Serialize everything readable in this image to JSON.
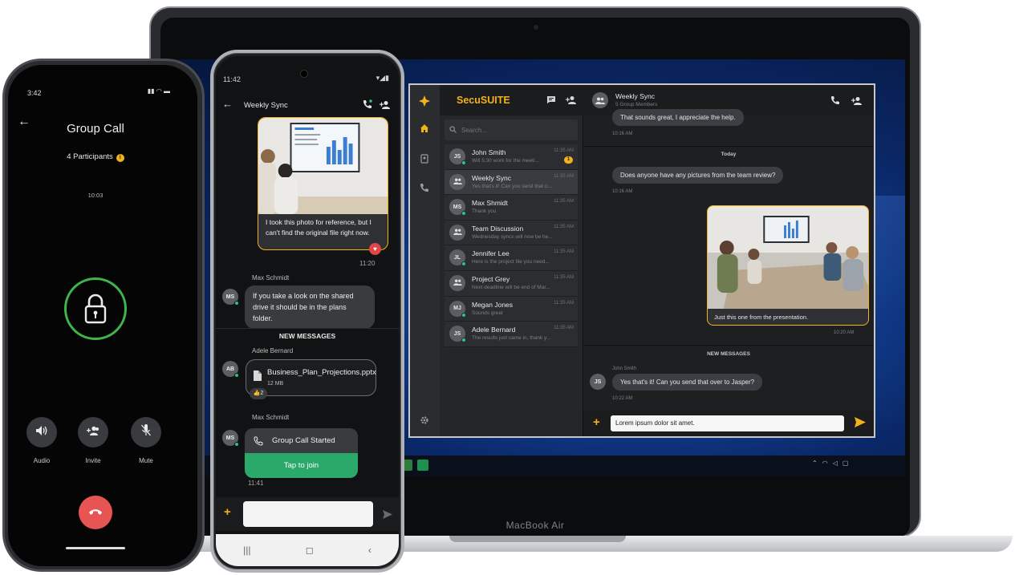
{
  "laptop": {
    "brand_label": "MacBook Air",
    "app": {
      "title": "SecuSUITE",
      "search_placeholder": "Search...",
      "conversations": [
        {
          "initials": "JS",
          "name": "John Smith",
          "preview": "Will 5:30 work for the meeti...",
          "time": "11:35 AM",
          "badge": "1",
          "type": "person"
        },
        {
          "initials": "",
          "name": "Weekly Sync",
          "preview": "Yes that's it! Can you send that o...",
          "time": "11:35 AM",
          "badge": "",
          "type": "group",
          "active": true
        },
        {
          "initials": "MS",
          "name": "Max Shmidt",
          "preview": "Thank you",
          "time": "11:35 AM",
          "badge": "",
          "type": "person"
        },
        {
          "initials": "",
          "name": "Team Discussion",
          "preview": "Wednesday syncs will now be he...",
          "time": "11:35 AM",
          "badge": "",
          "type": "group"
        },
        {
          "initials": "JL",
          "name": "Jennifer Lee",
          "preview": "Here is the project file you need...",
          "time": "11:35 AM",
          "badge": "",
          "type": "person"
        },
        {
          "initials": "",
          "name": "Project Grey",
          "preview": "Next deadline will be end of Mar...",
          "time": "11:35 AM",
          "badge": "",
          "type": "group"
        },
        {
          "initials": "MJ",
          "name": "Megan Jones",
          "preview": "Sounds great",
          "time": "11:35 AM",
          "badge": "",
          "type": "person"
        },
        {
          "initials": "JS",
          "name": "Adele Bernard",
          "preview": "The results just came in, thank y...",
          "time": "11:35 AM",
          "badge": "",
          "type": "person"
        }
      ],
      "chat": {
        "title": "Weekly Sync",
        "subtitle": "5 Group Members",
        "msg1": "That sounds great, I appreciate the help.",
        "msg1_time": "10:16 AM",
        "day_label": "Today",
        "msg2": "Does anyone have any pictures from the team review?",
        "msg2_time": "10:16 AM",
        "image_caption": "Just this one from the presentation.",
        "image_time": "10:20 AM",
        "new_messages": "NEW MESSAGES",
        "sender": "John Smith",
        "sender_initials": "JS",
        "msg3": "Yes that's it! Can you send that over to Jasper?",
        "msg3_time": "10:22 AM",
        "composer_value": "Lorem ipsum dolor sit amet."
      }
    }
  },
  "android": {
    "status_time": "11:42",
    "header_title": "Weekly Sync",
    "image_caption": "I took this photo for reference, but I can't find the original file right now.",
    "image_time": "11:20",
    "sender1": "Max Schmidt",
    "sender1_initials": "MS",
    "msg1": "If you take a look on the shared drive it should be in the plans folder.",
    "new_messages": "NEW MESSAGES",
    "sender2": "Adele Bernard",
    "sender2_initials": "AB",
    "file_name": "Business_Plan_Projections.pptx",
    "file_size": "12 MB",
    "reaction": "👍2",
    "sender3": "Max Schmidt",
    "sender3_initials": "MS",
    "call_label": "Group Call Started",
    "join_label": "Tap to join",
    "call_time": "11:41",
    "nav": [
      "|||",
      "◻",
      "‹"
    ]
  },
  "iphone": {
    "status_time": "3:42",
    "title": "Group Call",
    "participants": "4 Participants",
    "participants_badge": "i",
    "timer": "10:03",
    "controls": [
      {
        "label": "Audio"
      },
      {
        "label": "Invite"
      },
      {
        "label": "Mute"
      }
    ]
  },
  "colors": {
    "accent": "#f2b21a",
    "online": "#2ec27e",
    "join": "#2aa96a",
    "end_call": "#e65454",
    "lock_ring": "#3eb54b"
  }
}
